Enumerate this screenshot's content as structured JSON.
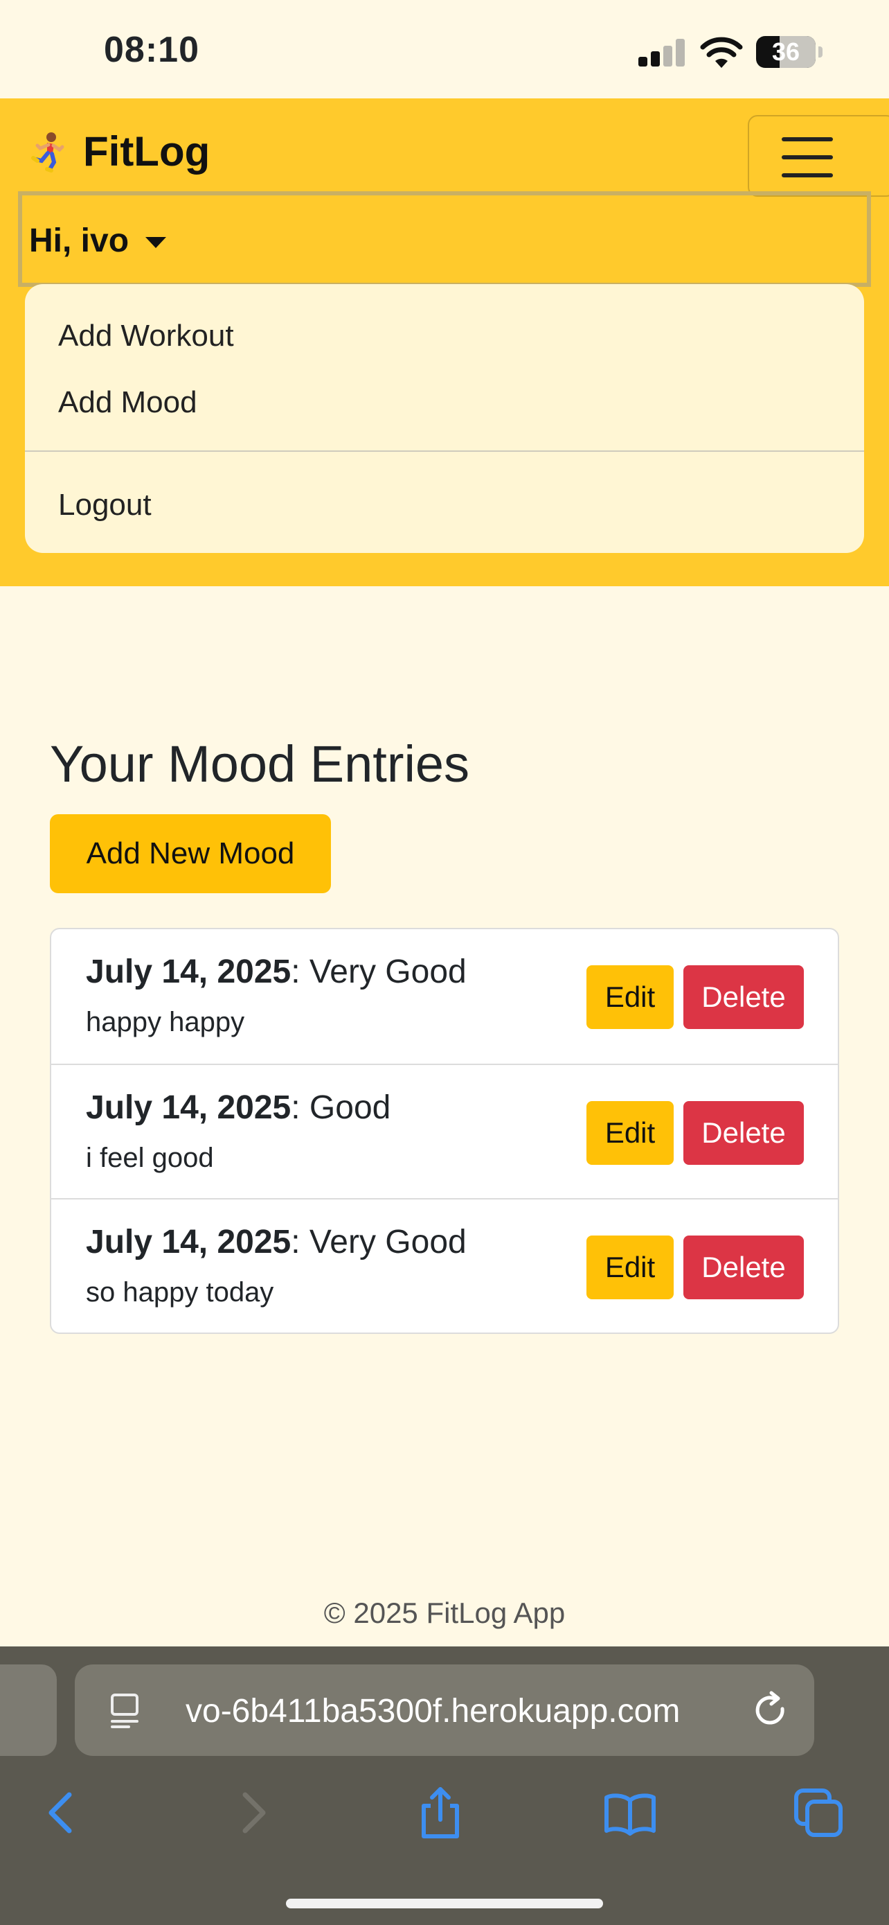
{
  "status_bar": {
    "time": "08:10",
    "battery_level": "36",
    "signal_bars_active": 2,
    "signal_bars_total": 4
  },
  "navbar": {
    "brand_icon": "runner-emoji",
    "brand": "FitLog",
    "user_toggle": "Hi, ivo",
    "dropdown": {
      "add_workout": "Add Workout",
      "add_mood": "Add Mood",
      "logout": "Logout"
    },
    "color": "#ffca2c"
  },
  "main": {
    "title": "Your Mood Entries",
    "add_button": "Add New Mood",
    "entries": [
      {
        "date": "July 14, 2025",
        "mood": "Very Good",
        "note": "happy happy",
        "edit": "Edit",
        "delete": "Delete"
      },
      {
        "date": "July 14, 2025",
        "mood": "Good",
        "note": "i feel good",
        "edit": "Edit",
        "delete": "Delete"
      },
      {
        "date": "July 14, 2025",
        "mood": "Very Good",
        "note": "so happy today",
        "edit": "Edit",
        "delete": "Delete"
      }
    ]
  },
  "footer": {
    "text": "© 2025 FitLog App"
  },
  "browser": {
    "url": "vo-6b411ba5300f.herokuapp.com",
    "icons": [
      "page-menu-icon",
      "reload-icon",
      "back-icon",
      "forward-icon",
      "share-icon",
      "bookmarks-icon",
      "tabs-icon"
    ]
  },
  "colors": {
    "background": "#fff9e5",
    "warning": "#ffc107",
    "danger": "#dc3545",
    "chrome": "#5b5950",
    "link_blue": "#3d8ef0"
  }
}
